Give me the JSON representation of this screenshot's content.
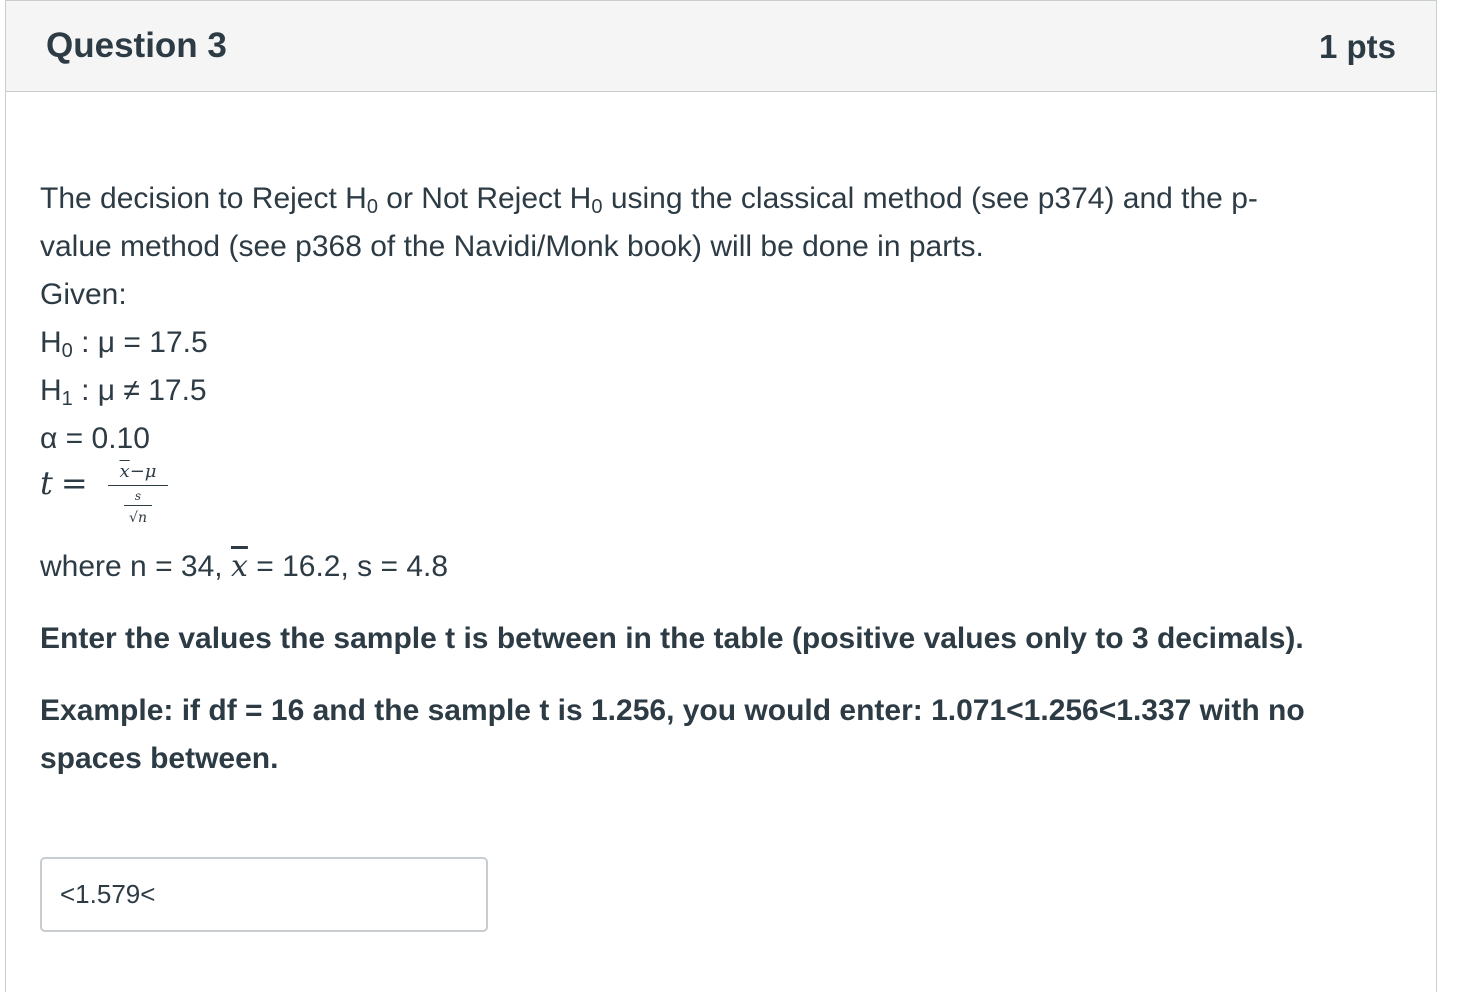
{
  "question": {
    "title": "Question 3",
    "points": "1 pts"
  },
  "body": {
    "intro_line1_a": "The decision to Reject H",
    "intro_sub0_a": "0",
    "intro_line1_b": " or Not Reject H",
    "intro_sub0_b": "0",
    "intro_line1_c": " using the classical method (see p374) and the p-",
    "intro_line2": "value method (see p368 of the Navidi/Monk book) will be done in parts.",
    "given_label": "Given:",
    "h0_prefix": "H",
    "h0_sub": "0",
    "h0_rest": " : μ = 17.5",
    "h1_prefix": "H",
    "h1_sub": "1",
    "h1_rest": " : μ ≠ 17.5",
    "alpha_line": "α = 0.10",
    "formula": {
      "lhs": "t",
      "eq": "=",
      "num_xbar": "x",
      "num_rest": "−μ",
      "den_s": "s",
      "den_sqrt_n": "√n"
    },
    "where_a": "where n = 34, ",
    "where_xbar": "x",
    "where_b": " = 16.2, s = 4.8",
    "instruction": "Enter the values the sample t is between in the table (positive values only to 3 decimals).",
    "example_line1": "Example: if df = 16 and the sample t is 1.256, you would enter: 1.071<1.256<1.337 with no",
    "example_line2": "spaces between."
  },
  "answer": {
    "value": "<1.579<"
  }
}
